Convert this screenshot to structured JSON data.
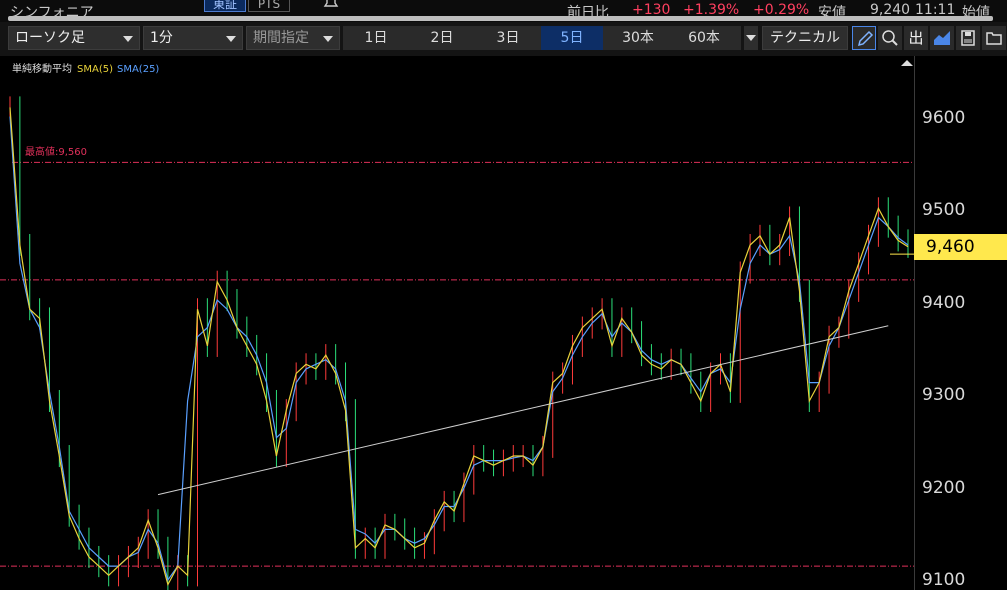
{
  "header": {
    "stock_name": "シンフォニア",
    "market_tag": "東証",
    "pts_tag": "PTS",
    "change_label": "前日比",
    "change_value": "+130",
    "change_pct": "+1.39%",
    "change_pct2": "+0.29%",
    "low_label": "安値",
    "low_value": "9,240",
    "low_time": "11:11",
    "open_label": "始値"
  },
  "toolbar": {
    "chart_type": "ローソク足",
    "interval": "1分",
    "period_select": "期間指定",
    "ranges": [
      "1日",
      "2日",
      "3日",
      "5日",
      "30本",
      "60本"
    ],
    "active_range": "5日",
    "technical_label": "テクニカル",
    "icon_out_label": "出"
  },
  "legend": {
    "title": "単純移動平均",
    "sma_short": "SMA(5)",
    "sma_long": "SMA(25)"
  },
  "highest_label": "最高値:9,560",
  "colors": {
    "sma_short": "#e8d23a",
    "sma_long": "#5aa0ff",
    "up": "#ff3b3b",
    "down": "#2be07a",
    "ref_line": "#e0305a",
    "current_price_bg": "#ffe84d",
    "active_tab": "#0d2e66"
  },
  "chart_data": {
    "type": "line",
    "xlabel": "",
    "ylabel": "",
    "ylim": [
      9094,
      9676
    ],
    "y_ticks": [
      "9600",
      "9500",
      "9400",
      "9300",
      "9200",
      "9100"
    ],
    "current_price": "9,460",
    "current_price_value": 9460,
    "ref_lines": [
      {
        "value": 9560,
        "label": "最高値:9,560"
      },
      {
        "value": 9432
      },
      {
        "value": 9120
      }
    ],
    "trendline": {
      "start_index": 15,
      "start_value": 9198,
      "end_index": 89,
      "end_value": 9382
    },
    "x_count": 92,
    "series": [
      {
        "name": "SMA(5)",
        "values": [
          9620,
          9470,
          9400,
          9390,
          9300,
          9240,
          9175,
          9150,
          9130,
          9120,
          9110,
          9120,
          9130,
          9140,
          9170,
          9140,
          9100,
          9120,
          9110,
          9400,
          9360,
          9430,
          9410,
          9380,
          9360,
          9340,
          9300,
          9240,
          9290,
          9330,
          9340,
          9335,
          9350,
          9330,
          9290,
          9140,
          9150,
          9140,
          9165,
          9160,
          9150,
          9140,
          9145,
          9170,
          9190,
          9180,
          9210,
          9240,
          9235,
          9230,
          9235,
          9240,
          9240,
          9230,
          9250,
          9320,
          9330,
          9360,
          9380,
          9390,
          9400,
          9360,
          9390,
          9375,
          9350,
          9340,
          9335,
          9345,
          9340,
          9320,
          9300,
          9330,
          9340,
          9310,
          9440,
          9470,
          9480,
          9460,
          9470,
          9500,
          9420,
          9300,
          9320,
          9370,
          9380,
          9420,
          9450,
          9480,
          9510,
          9490,
          9475,
          9468
        ]
      },
      {
        "name": "SMA(25)",
        "values": [
          9610,
          9450,
          9400,
          9380,
          9310,
          9250,
          9180,
          9160,
          9140,
          9130,
          9120,
          9120,
          9130,
          9135,
          9160,
          9145,
          9105,
          9120,
          9300,
          9370,
          9380,
          9410,
          9400,
          9380,
          9370,
          9350,
          9320,
          9260,
          9270,
          9320,
          9335,
          9340,
          9345,
          9335,
          9300,
          9160,
          9155,
          9145,
          9160,
          9160,
          9150,
          9145,
          9150,
          9165,
          9185,
          9185,
          9205,
          9230,
          9235,
          9235,
          9235,
          9238,
          9240,
          9235,
          9250,
          9310,
          9325,
          9350,
          9370,
          9385,
          9395,
          9370,
          9385,
          9375,
          9355,
          9345,
          9340,
          9345,
          9340,
          9325,
          9310,
          9330,
          9335,
          9320,
          9400,
          9450,
          9470,
          9460,
          9465,
          9480,
          9430,
          9320,
          9320,
          9360,
          9380,
          9410,
          9440,
          9470,
          9500,
          9490,
          9478,
          9470
        ]
      }
    ]
  }
}
